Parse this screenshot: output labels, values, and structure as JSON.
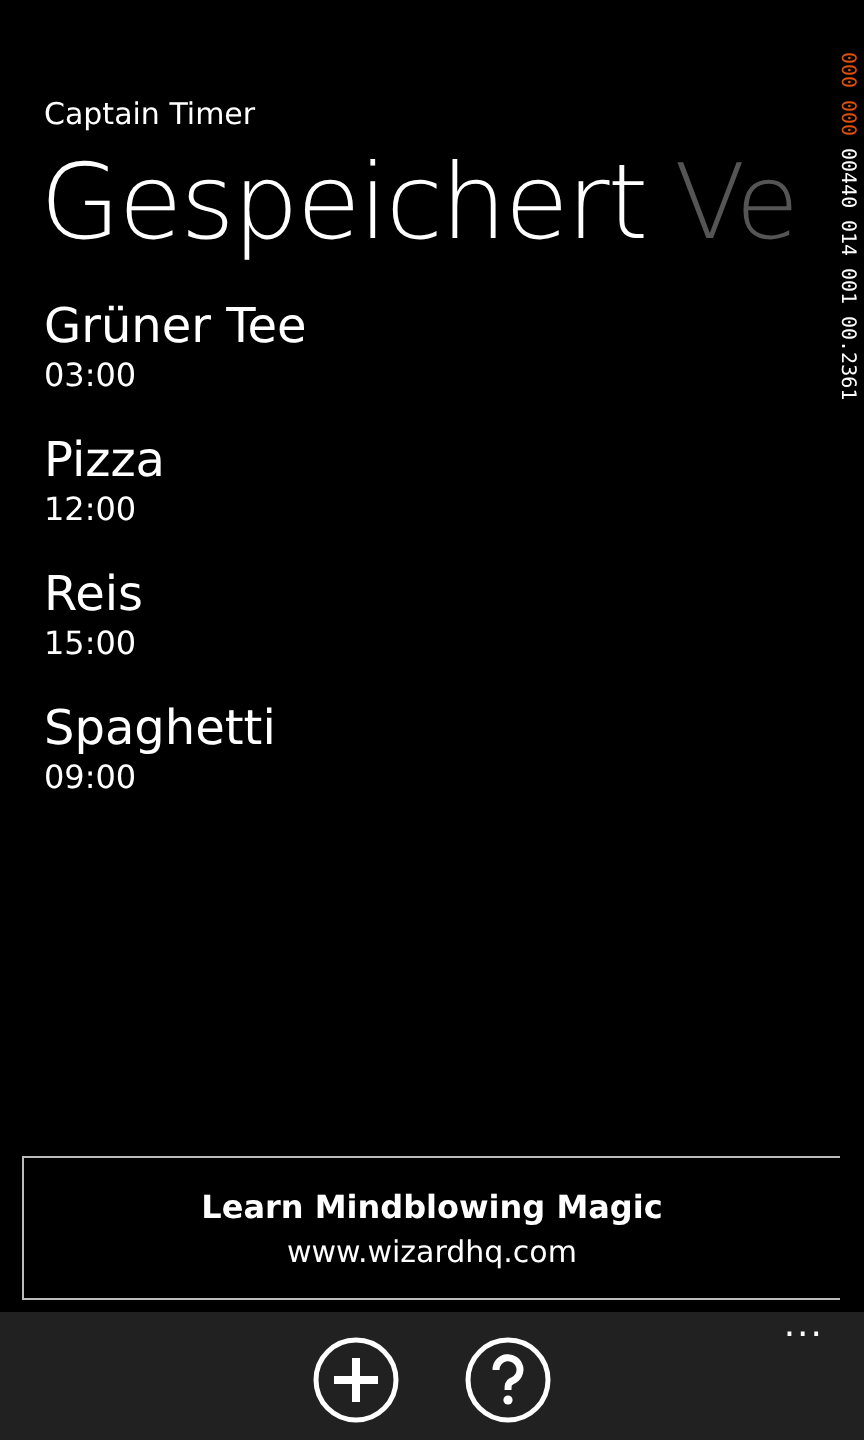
{
  "app_title": "Captain Timer",
  "pivot_headers": [
    {
      "label": "Gespeichert",
      "selected": true
    },
    {
      "label": "Ve",
      "selected": false
    }
  ],
  "timers": [
    {
      "name": "Grüner Tee",
      "duration": "03:00"
    },
    {
      "name": "Pizza",
      "duration": "12:00"
    },
    {
      "name": "Reis",
      "duration": "15:00"
    },
    {
      "name": "Spaghetti",
      "duration": "09:00"
    }
  ],
  "frame_counters": [
    {
      "text": "000",
      "color": "#e0500a"
    },
    {
      "text": "000",
      "color": "#e0500a"
    },
    {
      "text": "00440",
      "color": "#ffffff"
    },
    {
      "text": "014",
      "color": "#ffffff"
    },
    {
      "text": "001",
      "color": "#ffffff"
    },
    {
      "text": "00.2361",
      "color": "#ffffff"
    }
  ],
  "ad": {
    "title": "Learn Mindblowing Magic",
    "url": "www.wizardhq.com"
  },
  "app_bar": {
    "buttons": [
      {
        "kind": "add"
      },
      {
        "kind": "help"
      }
    ],
    "more": "..."
  }
}
